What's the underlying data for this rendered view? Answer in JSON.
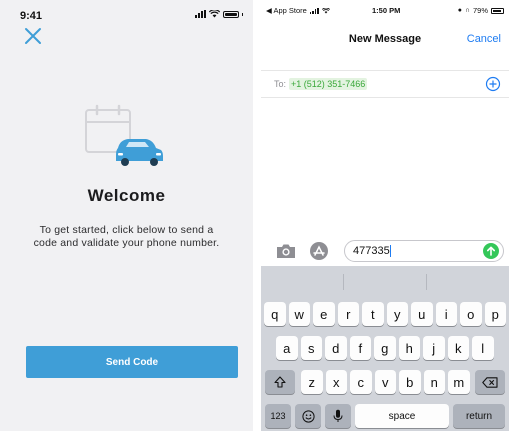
{
  "left": {
    "status_time": "9:41",
    "welcome_title": "Welcome",
    "welcome_body": "To get started, click below to send a code and validate your phone number.",
    "send_code_label": "Send Code"
  },
  "right": {
    "status": {
      "back_app": "◀ App Store",
      "time": "1:50 PM",
      "battery": "79%"
    },
    "nav": {
      "title": "New Message",
      "cancel": "Cancel"
    },
    "to": {
      "label": "To:",
      "recipient": "+1 (512) 351-7466"
    },
    "compose": {
      "value": "477335"
    },
    "keyboard": {
      "row1": [
        "q",
        "w",
        "e",
        "r",
        "t",
        "y",
        "u",
        "i",
        "o",
        "p"
      ],
      "row2": [
        "a",
        "s",
        "d",
        "f",
        "g",
        "h",
        "j",
        "k",
        "l"
      ],
      "row3": [
        "z",
        "x",
        "c",
        "v",
        "b",
        "n",
        "m"
      ],
      "numbers": "123",
      "space": "space",
      "return": "return"
    }
  },
  "colors": {
    "accent_blue": "#3f9ed7",
    "ios_blue": "#1e7cf2",
    "sms_green": "#3aa83a"
  },
  "icons": [
    "close-icon",
    "calendar-car-illustration",
    "camera-icon",
    "app-store-icon",
    "send-arrow-icon",
    "add-contact-icon",
    "shift-icon",
    "backspace-icon",
    "emoji-icon",
    "microphone-icon"
  ]
}
